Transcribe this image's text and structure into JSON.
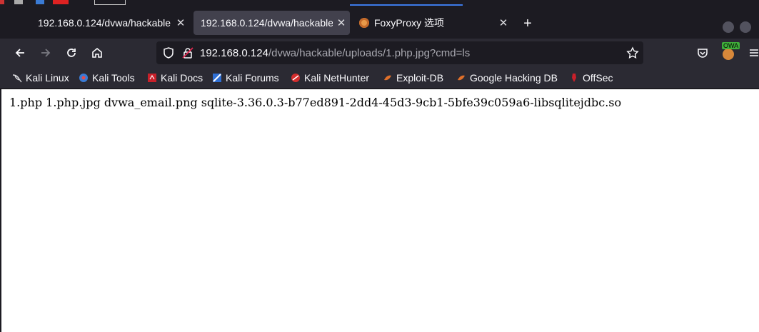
{
  "tabs": [
    {
      "label": "192.168.0.124/dvwa/hackable",
      "active": false
    },
    {
      "label": "192.168.0.124/dvwa/hackable",
      "active": true
    },
    {
      "label": "FoxyProxy 选项",
      "active": false
    }
  ],
  "url": {
    "host": "192.168.0.124",
    "path": "/dvwa/hackable/uploads/1.php.jpg?cmd=ls"
  },
  "extension_badge": "OWA",
  "bookmarks": [
    {
      "label": "Kali Linux",
      "icon": "kali-dragon-icon"
    },
    {
      "label": "Kali Tools",
      "icon": "kali-tools-icon"
    },
    {
      "label": "Kali Docs",
      "icon": "kali-docs-icon"
    },
    {
      "label": "Kali Forums",
      "icon": "kali-forums-icon"
    },
    {
      "label": "Kali NetHunter",
      "icon": "nethunter-icon"
    },
    {
      "label": "Exploit-DB",
      "icon": "exploit-db-icon"
    },
    {
      "label": "Google Hacking DB",
      "icon": "ghdb-icon"
    },
    {
      "label": "OffSec",
      "icon": "offsec-icon"
    }
  ],
  "page": {
    "text": "1.php 1.php.jpg dvwa_email.png sqlite-3.36.0.3-b77ed891-2dd4-45d3-9cb1-5bfe39c059a6-libsqlitejdbc.so"
  },
  "colors": {
    "chrome_dark": "#1c1b22",
    "toolbar": "#2b2a33",
    "active_tab": "#42414d",
    "text": "#fbfbfe"
  }
}
